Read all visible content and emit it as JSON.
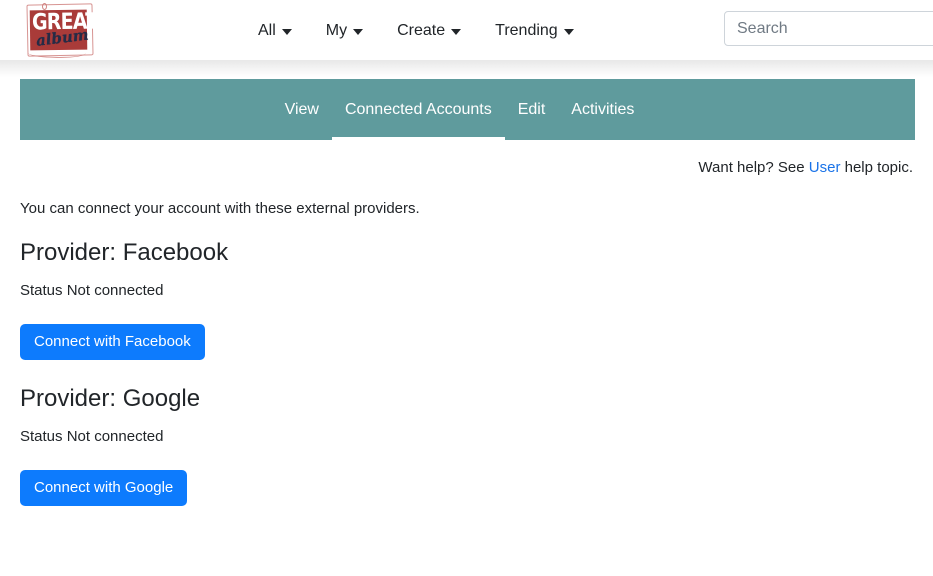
{
  "header": {
    "logo": {
      "main_text": "GREAT",
      "script_text": "album",
      "brand_red": "#a93b39"
    },
    "nav": [
      {
        "label": "All",
        "has_caret": true
      },
      {
        "label": "My",
        "has_caret": true
      },
      {
        "label": "Create",
        "has_caret": true
      },
      {
        "label": "Trending",
        "has_caret": true
      }
    ],
    "search": {
      "placeholder": "Search",
      "value": ""
    }
  },
  "tabbar": {
    "accent_color": "#5f9b9d",
    "tabs": [
      {
        "label": "View",
        "active": false
      },
      {
        "label": "Connected Accounts",
        "active": true
      },
      {
        "label": "Edit",
        "active": false
      },
      {
        "label": "Activities",
        "active": false
      }
    ]
  },
  "help": {
    "prefix": "Want help? See ",
    "link_label": "User",
    "suffix": " help topic.",
    "link_color": "#1a73e8"
  },
  "main": {
    "intro": "You can connect your account with these external providers.",
    "providers": [
      {
        "title": "Provider: Facebook",
        "status": "Status Not connected",
        "button_label": "Connect with Facebook",
        "button_color": "#0d7bfd"
      },
      {
        "title": "Provider: Google",
        "status": "Status Not connected",
        "button_label": "Connect with Google",
        "button_color": "#0d7bfd"
      }
    ]
  }
}
